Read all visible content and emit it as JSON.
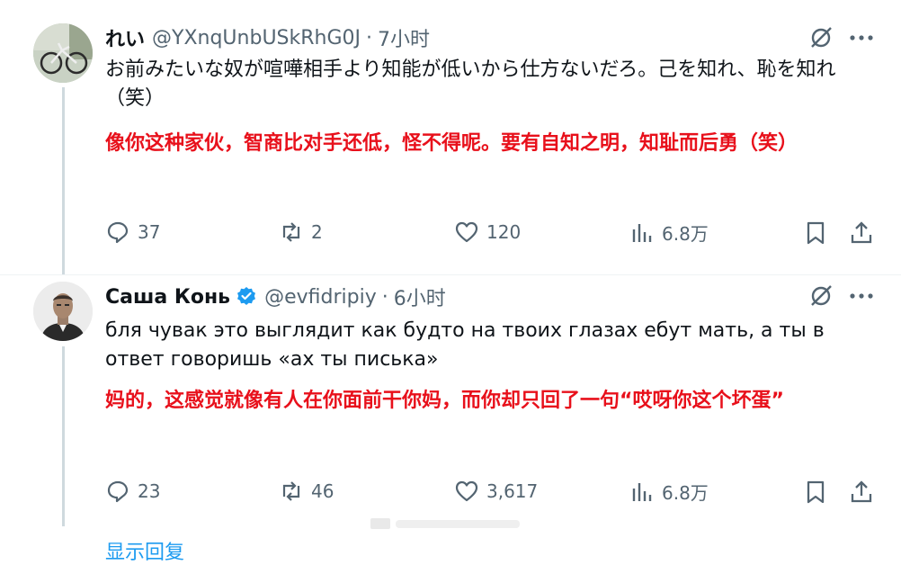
{
  "tweets": [
    {
      "name": "れい",
      "handle": "@YXnqUnbUSkRhG0J",
      "sep": "·",
      "time": "7小时",
      "text": "お前みたいな奴が喧嘩相手より知能が低いから仕方ないだろ。己を知れ、恥を知れ（笑）",
      "translation": "像你这种家伙，智商比对手还低，怪不得呢。要有自知之明，知耻而后勇（笑）",
      "replies": "37",
      "retweets": "2",
      "likes": "120",
      "views": "6.8万",
      "verified": false
    },
    {
      "name": "Саша Конь",
      "handle": "@evfidripiy",
      "sep": "·",
      "time": "6小时",
      "text": "бля чувак это выглядит как будто на твоих глазах ебут мать, а ты в ответ говоришь «ах ты писька»",
      "translation": "妈的，这感觉就像有人在你面前干你妈，而你却只回了一句“哎呀你这个坏蛋”",
      "replies": "23",
      "retweets": "46",
      "likes": "3,617",
      "views": "6.8万",
      "verified": true
    }
  ],
  "show_more": "显示回复",
  "colors": {
    "accent": "#1d9bf0",
    "translation": "#e8101b",
    "muted": "#536471",
    "thread_line": "#cfd9de"
  },
  "icons": {
    "grok": "grok-icon",
    "more": "more-dots-icon",
    "reply": "reply-icon",
    "retweet": "retweet-icon",
    "like": "heart-icon",
    "views": "views-icon",
    "bookmark": "bookmark-icon",
    "share": "share-icon",
    "verified": "verified-badge-icon"
  }
}
